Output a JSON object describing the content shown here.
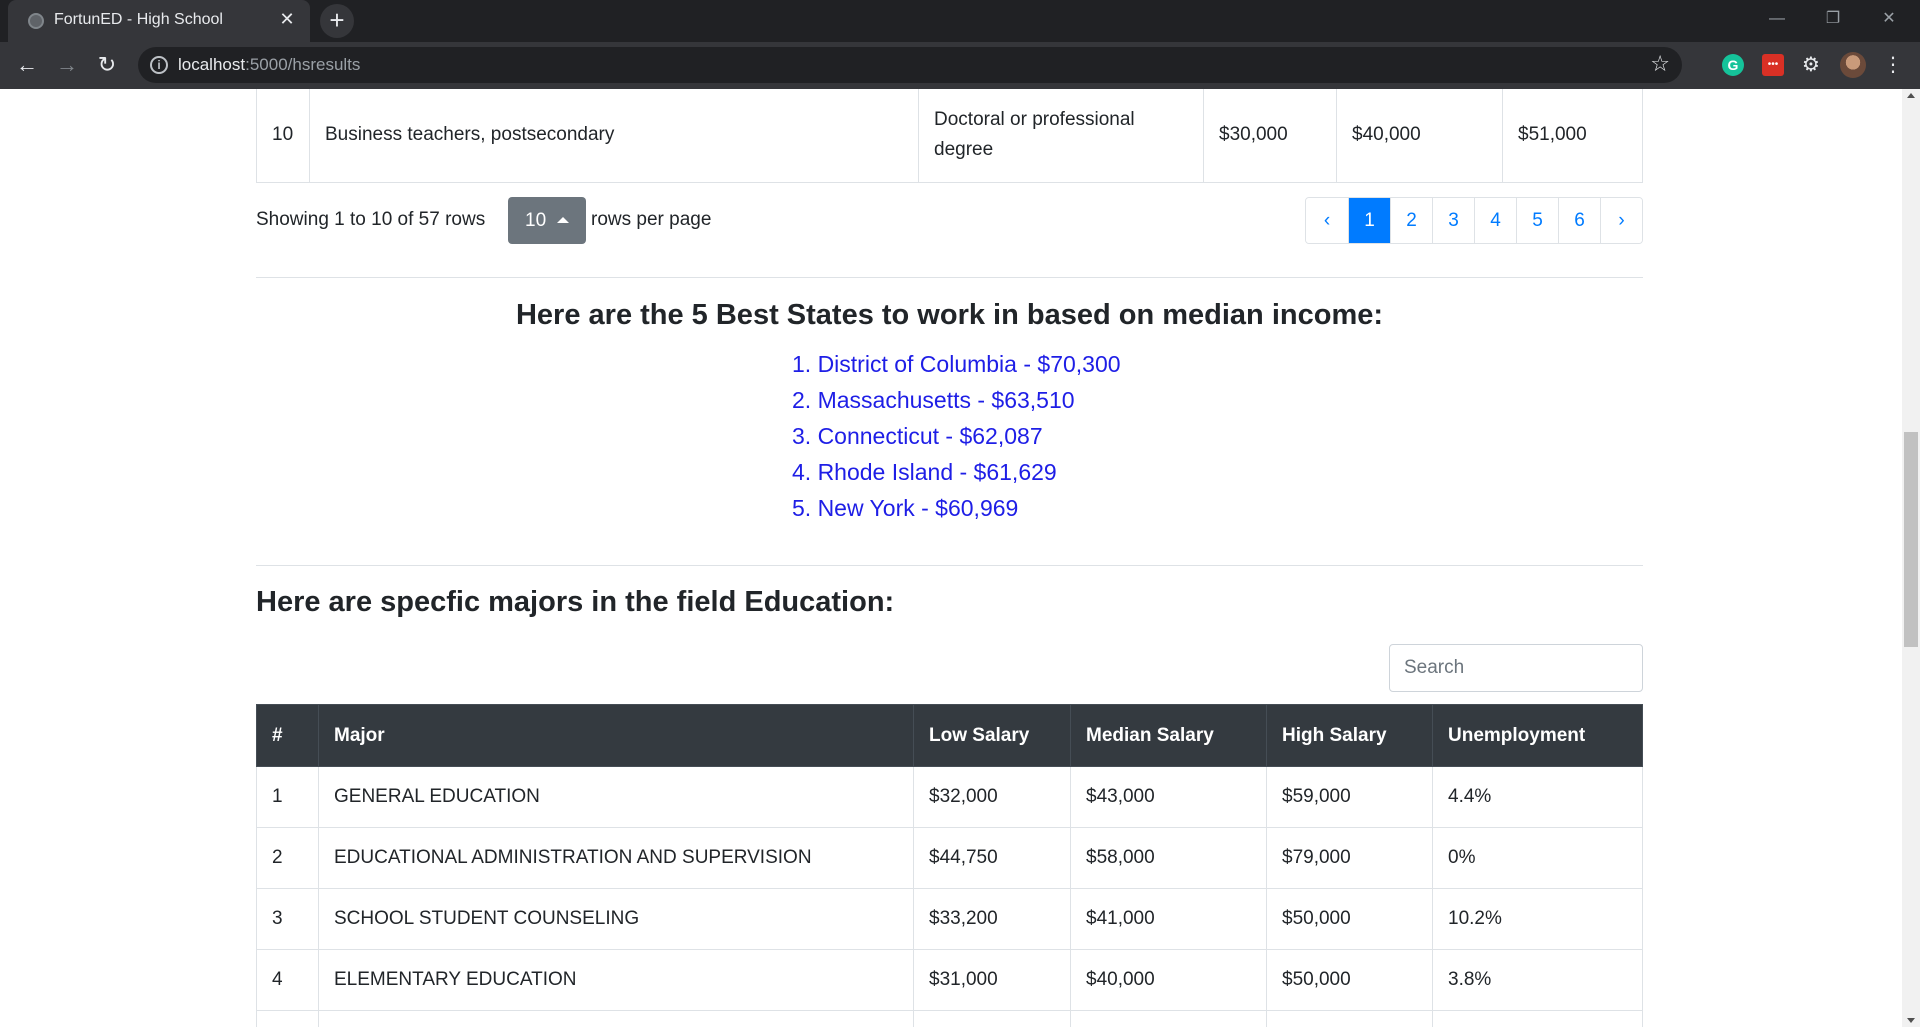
{
  "browser": {
    "tab_title": "FortunED - High School",
    "url_host": "localhost",
    "url_path": ":5000/hsresults",
    "new_tab": "+",
    "close_tab": "✕"
  },
  "prev_table_row": {
    "num": "10",
    "occupation": "Business teachers, postsecondary",
    "education": "Doctoral or professional degree",
    "low": "$30,000",
    "median": "$40,000",
    "high": "$51,000"
  },
  "pager": {
    "showing": "Showing 1 to 10 of 57 rows",
    "rows_per_page_value": "10",
    "rows_per_page_label": "rows per page",
    "prev": "‹",
    "next": "›",
    "pages": [
      "1",
      "2",
      "3",
      "4",
      "5",
      "6"
    ]
  },
  "states": {
    "title": "Here are the 5 Best States to work in based on median income:",
    "items": [
      "1. District of Columbia - $70,300",
      "2. Massachusetts - $63,510",
      "3. Connecticut - $62,087",
      "4. Rhode Island - $61,629",
      "5. New York - $60,969"
    ]
  },
  "majors": {
    "title": "Here are specfic majors in the field Education:",
    "search_placeholder": "Search",
    "headers": [
      "#",
      "Major",
      "Low Salary",
      "Median Salary",
      "High Salary",
      "Unemployment"
    ],
    "rows": [
      [
        "1",
        "GENERAL EDUCATION",
        "$32,000",
        "$43,000",
        "$59,000",
        "4.4%"
      ],
      [
        "2",
        "EDUCATIONAL ADMINISTRATION AND SUPERVISION",
        "$44,750",
        "$58,000",
        "$79,000",
        "0%"
      ],
      [
        "3",
        "SCHOOL STUDENT COUNSELING",
        "$33,200",
        "$41,000",
        "$50,000",
        "10.2%"
      ],
      [
        "4",
        "ELEMENTARY EDUCATION",
        "$31,000",
        "$40,000",
        "$50,000",
        "3.8%"
      ]
    ]
  }
}
